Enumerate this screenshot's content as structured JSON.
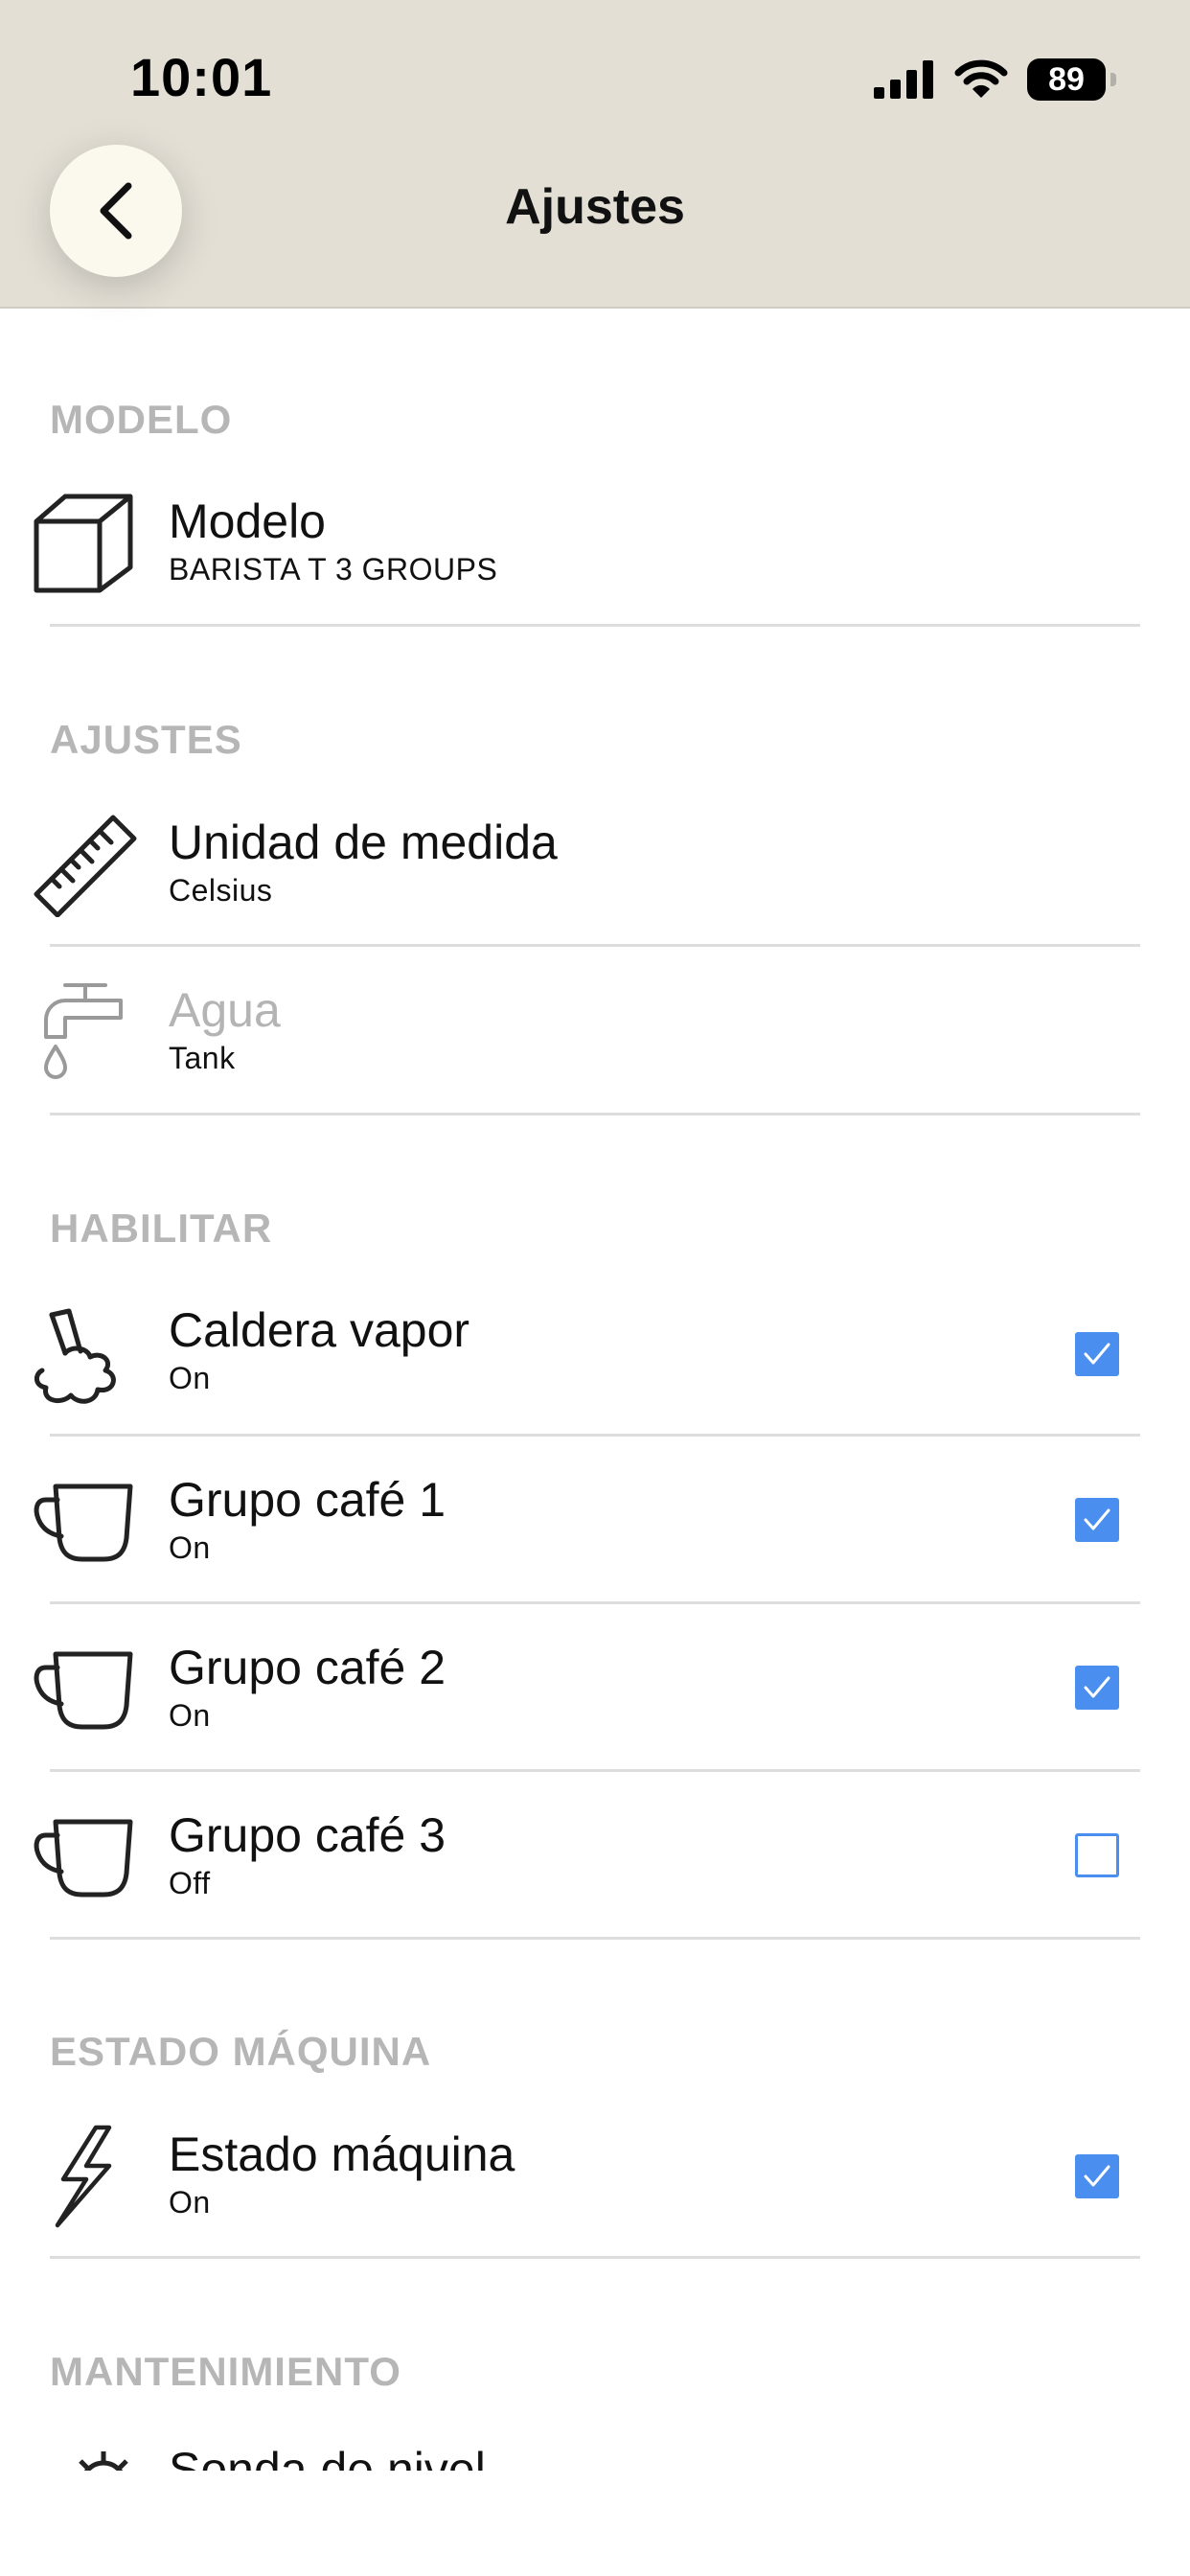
{
  "status_bar": {
    "time": "10:01",
    "battery": "89"
  },
  "header": {
    "title": "Ajustes"
  },
  "sections": {
    "modelo": {
      "title": "MODELO",
      "items": [
        {
          "title": "Modelo",
          "subtitle": "BARISTA T 3 GROUPS"
        }
      ]
    },
    "ajustes": {
      "title": "AJUSTES",
      "items": [
        {
          "title": "Unidad de medida",
          "subtitle": "Celsius"
        },
        {
          "title": "Agua",
          "subtitle": "Tank"
        }
      ]
    },
    "habilitar": {
      "title": "HABILITAR",
      "items": [
        {
          "title": "Caldera vapor",
          "subtitle": "On",
          "checked": true
        },
        {
          "title": "Grupo café 1",
          "subtitle": "On",
          "checked": true
        },
        {
          "title": "Grupo café 2",
          "subtitle": "On",
          "checked": true
        },
        {
          "title": "Grupo café 3",
          "subtitle": "Off",
          "checked": false
        }
      ]
    },
    "estado": {
      "title": "ESTADO MÁQUINA",
      "items": [
        {
          "title": "Estado máquina",
          "subtitle": "On",
          "checked": true
        }
      ]
    },
    "mantenimiento": {
      "title": "MANTENIMIENTO",
      "items": [
        {
          "title": "Sonda de nivel"
        }
      ]
    }
  },
  "colors": {
    "header_bg": "#e3dfd5",
    "accent": "#4a8ff0",
    "section_header": "#b6b6b6",
    "disabled_text": "#b4b4b4"
  }
}
